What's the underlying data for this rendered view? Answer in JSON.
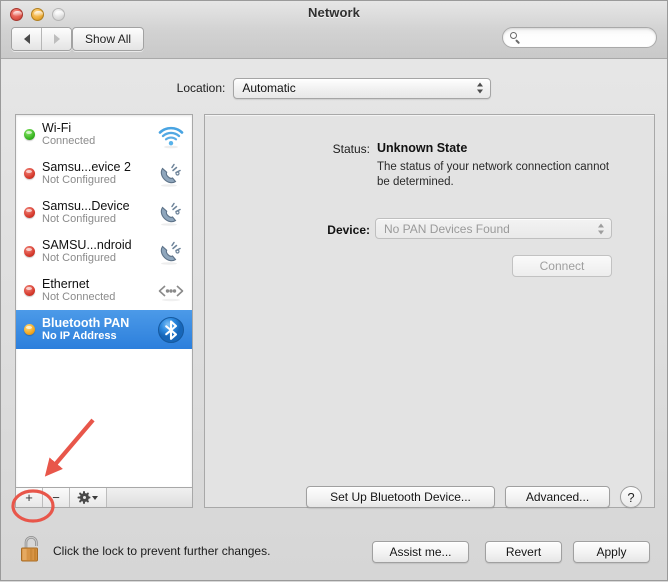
{
  "window": {
    "title": "Network",
    "traffic_lights": [
      {
        "name": "close",
        "color": "#e1554a"
      },
      {
        "name": "minimize",
        "color": "#eead38"
      },
      {
        "name": "zoom",
        "color": "#dcdcdc"
      }
    ]
  },
  "toolbar": {
    "back_icon": "triangle-left-icon",
    "forward_icon": "triangle-right-icon",
    "show_all_label": "Show All",
    "search": {
      "value": "",
      "placeholder": "",
      "icon": "search-icon"
    }
  },
  "location": {
    "label": "Location:",
    "selected": "Automatic",
    "options": [
      "Automatic"
    ]
  },
  "sidebar": {
    "services": [
      {
        "name": "Wi-Fi",
        "status": "Connected",
        "dot": "green",
        "icon": "wifi-icon",
        "selected": false
      },
      {
        "name": "Samsu...evice 2",
        "status": "Not Configured",
        "dot": "red",
        "icon": "modem-phone-icon",
        "selected": false
      },
      {
        "name": "Samsu...Device",
        "status": "Not Configured",
        "dot": "red",
        "icon": "modem-phone-icon",
        "selected": false
      },
      {
        "name": "SAMSU...ndroid",
        "status": "Not Configured",
        "dot": "red",
        "icon": "modem-phone-icon",
        "selected": false
      },
      {
        "name": "Ethernet",
        "status": "Not Connected",
        "dot": "red",
        "icon": "ethernet-icon",
        "selected": false
      },
      {
        "name": "Bluetooth PAN",
        "status": "No IP Address",
        "dot": "amber",
        "icon": "bluetooth-icon",
        "selected": true
      }
    ],
    "toolbar": {
      "add_label": "+",
      "remove_label": "−",
      "action_icon": "gear-icon",
      "action_caret": "chevron-down-icon"
    }
  },
  "panel": {
    "status_label": "Status:",
    "status_value": "Unknown State",
    "status_description": "The status of your network connection cannot be determined.",
    "device_label": "Device:",
    "device_value": "No PAN Devices Found",
    "connect_label": "Connect",
    "setup_label": "Set Up Bluetooth Device...",
    "advanced_label": "Advanced...",
    "help_label": "?"
  },
  "footer": {
    "lock_icon": "unlocked-padlock-icon",
    "lock_text": "Click the lock to prevent further changes.",
    "assist_label": "Assist me...",
    "revert_label": "Revert",
    "apply_label": "Apply"
  },
  "annotations": {
    "arrow_color": "#e8564a",
    "circle_color": "#e8564a",
    "arrow_target": "add-service-button",
    "circle_target": "add-service-button"
  }
}
